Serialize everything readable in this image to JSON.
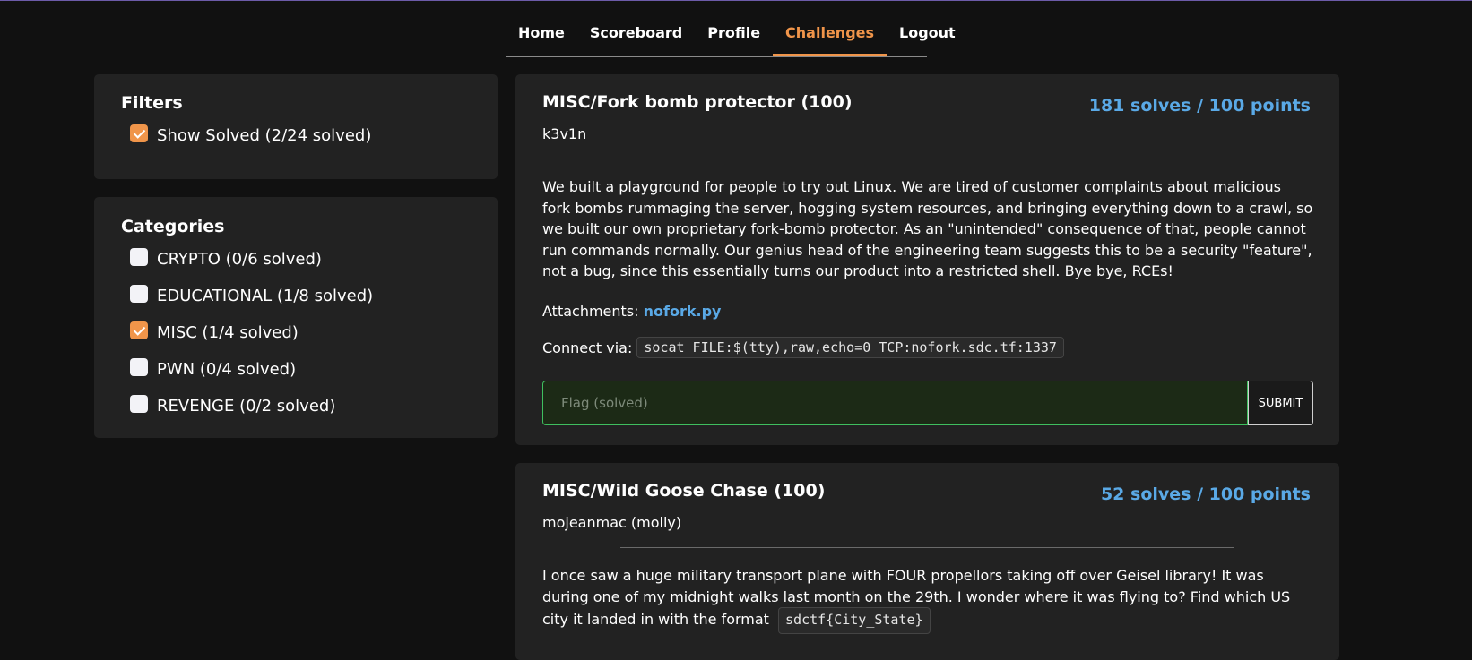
{
  "nav": {
    "home": "Home",
    "scoreboard": "Scoreboard",
    "profile": "Profile",
    "challenges": "Challenges",
    "logout": "Logout",
    "active": "challenges"
  },
  "filters": {
    "title": "Filters",
    "show_solved": {
      "label": "Show Solved (2/24 solved)",
      "checked": true
    }
  },
  "categories": {
    "title": "Categories",
    "items": [
      {
        "label": "CRYPTO (0/6 solved)",
        "checked": false
      },
      {
        "label": "EDUCATIONAL (1/8 solved)",
        "checked": false
      },
      {
        "label": "MISC (1/4 solved)",
        "checked": true
      },
      {
        "label": "PWN (0/4 solved)",
        "checked": false
      },
      {
        "label": "REVENGE (0/2 solved)",
        "checked": false
      }
    ]
  },
  "challenges": [
    {
      "title": "MISC/Fork bomb protector (100)",
      "solves_points": "181 solves / 100 points",
      "author": "k3v1n",
      "description": "We built a playground for people to try out Linux. We are tired of customer complaints about malicious fork bombs rummaging the server, hogging system resources, and bringing everything down to a crawl, so we built our own proprietary fork-bomb protector. As an \"unintended\" consequence of that, people cannot run commands normally. Our genius head of the engineering team suggests this to be a security \"feature\", not a bug, since this essentially turns our product into a restricted shell. Bye bye, RCEs!",
      "attachments_label": "Attachments:",
      "attachment": "nofork.py",
      "connect_label": "Connect via:",
      "connect_cmd": "socat FILE:$(tty),raw,echo=0 TCP:nofork.sdc.tf:1337",
      "flag_placeholder": "Flag (solved)",
      "submit_label": "SUBMIT",
      "solved": true
    },
    {
      "title": "MISC/Wild Goose Chase (100)",
      "solves_points": "52 solves / 100 points",
      "author": "mojeanmac (molly)",
      "description": "I once saw a huge military transport plane with FOUR propellors taking off over Geisel library! It was during one of my midnight walks last month on the 29th. I wonder where it was flying to? Find which US city it landed in with the format",
      "flag_format": "sdctf{City_State}"
    }
  ],
  "colors": {
    "accent": "#f0954a",
    "link": "#5aa9e6",
    "success_border": "#3fbf5f",
    "panel_bg": "#222222",
    "page_bg": "#111111"
  }
}
